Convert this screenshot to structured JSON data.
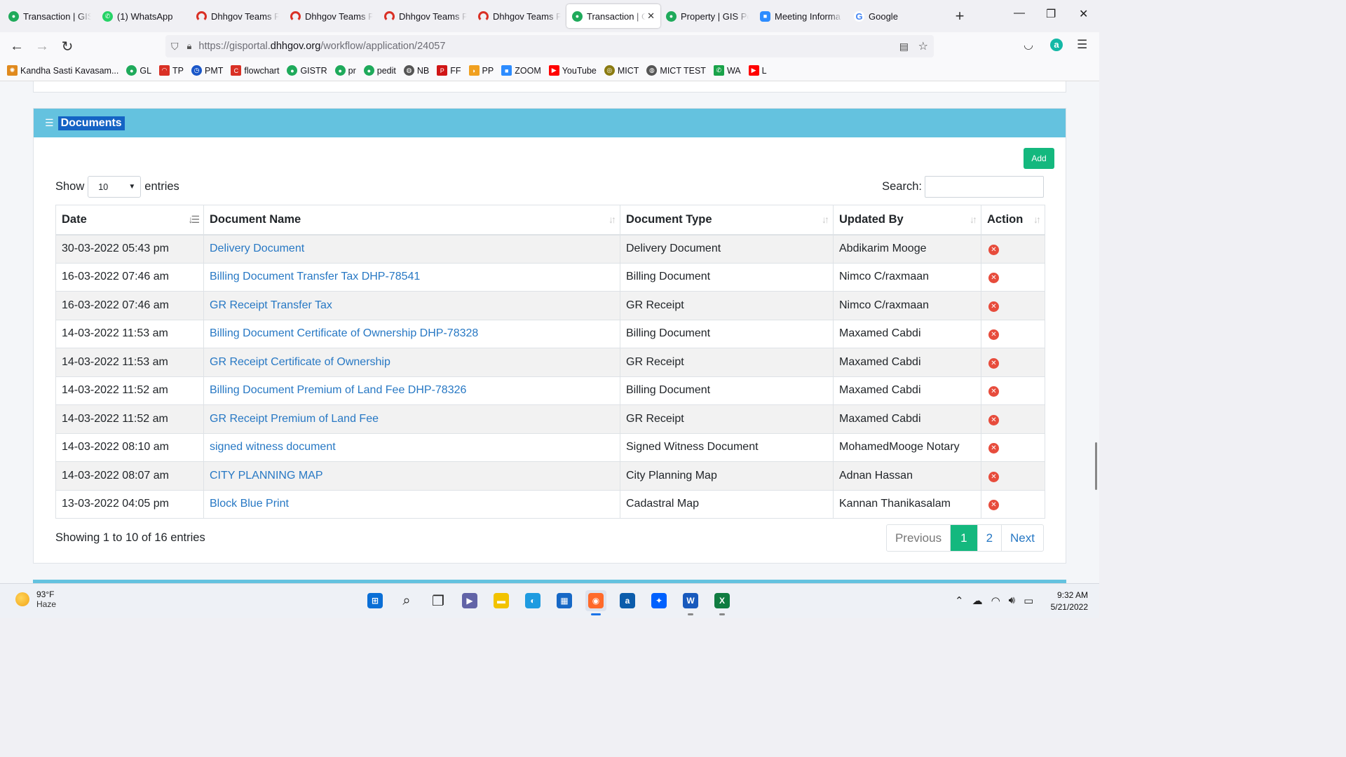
{
  "browser": {
    "tabs": [
      {
        "title": "Transaction | GIS",
        "favicon": "green",
        "icon_name": "gis-favicon-icon"
      },
      {
        "title": "(1) WhatsApp",
        "favicon": "wa",
        "icon_name": "whatsapp-icon"
      },
      {
        "title": "Dhhgov Teams P",
        "favicon": "redarc",
        "icon_name": "teams-portal-icon"
      },
      {
        "title": "Dhhgov Teams P",
        "favicon": "redarc",
        "icon_name": "teams-portal-icon"
      },
      {
        "title": "Dhhgov Teams P",
        "favicon": "redarc",
        "icon_name": "teams-portal-icon"
      },
      {
        "title": "Dhhgov Teams P",
        "favicon": "redarc",
        "icon_name": "teams-portal-icon"
      },
      {
        "title": "Transaction | G",
        "favicon": "green",
        "icon_name": "gis-favicon-icon",
        "active": true
      },
      {
        "title": "Property | GIS Po",
        "favicon": "green",
        "icon_name": "gis-favicon-icon"
      },
      {
        "title": "Meeting Informa",
        "favicon": "zoom",
        "icon_name": "zoom-icon"
      },
      {
        "title": "Google",
        "favicon": "google",
        "icon_name": "google-icon"
      }
    ],
    "url_prefix": "https://gisportal.",
    "url_domain": "dhhgov.org",
    "url_path": "/workflow/application/24057",
    "bookmarks": [
      {
        "label": "Kandha Sasti Kavasam...",
        "icon": "kandha-icon",
        "color": "#e08a1e"
      },
      {
        "label": "GL",
        "icon": "gis-favicon-icon",
        "color": "#1faa5b"
      },
      {
        "label": "TP",
        "icon": "teams-portal-icon",
        "color": "#d93025"
      },
      {
        "label": "PMT",
        "icon": "pmt-icon",
        "color": "#1a57c9"
      },
      {
        "label": "flowchart",
        "icon": "flowchart-icon",
        "color": "#d93025"
      },
      {
        "label": "GISTR",
        "icon": "gis-favicon-icon",
        "color": "#1faa5b"
      },
      {
        "label": "pr",
        "icon": "gis-favicon-icon",
        "color": "#1faa5b"
      },
      {
        "label": "pedit",
        "icon": "gis-favicon-icon",
        "color": "#1faa5b"
      },
      {
        "label": "NB",
        "icon": "globe-icon",
        "color": "#555555"
      },
      {
        "label": "FF",
        "icon": "ff-icon",
        "color": "#d01616"
      },
      {
        "label": "PP",
        "icon": "pp-icon",
        "color": "#f0a020"
      },
      {
        "label": "ZOOM",
        "icon": "zoom-icon",
        "color": "#2d8cff"
      },
      {
        "label": "YouTube",
        "icon": "youtube-icon",
        "color": "#ff0000"
      },
      {
        "label": "MICT",
        "icon": "mict-icon",
        "color": "#8a7a10"
      },
      {
        "label": "MICT TEST",
        "icon": "globe-icon",
        "color": "#555555"
      },
      {
        "label": "WA",
        "icon": "whatsapp-icon",
        "color": "#1aa34a"
      },
      {
        "label": "L",
        "icon": "youtube-icon",
        "color": "#ff0000"
      }
    ]
  },
  "documents": {
    "title": "Documents",
    "add_label": "Add",
    "show_label": "Show",
    "entries_label": "entries",
    "page_length": "10",
    "search_label": "Search:",
    "search_value": "",
    "columns": [
      "Date",
      "Document Name",
      "Document Type",
      "Updated By",
      "Action"
    ],
    "rows": [
      {
        "date": "30-03-2022 05:43 pm",
        "name": "Delivery Document",
        "type": "Delivery Document",
        "updated_by": "Abdikarim Mooge"
      },
      {
        "date": "16-03-2022 07:46 am",
        "name": "Billing Document Transfer Tax DHP-78541",
        "type": "Billing Document",
        "updated_by": "Nimco C/raxmaan"
      },
      {
        "date": "16-03-2022 07:46 am",
        "name": "GR Receipt Transfer Tax",
        "type": "GR Receipt",
        "updated_by": "Nimco C/raxmaan"
      },
      {
        "date": "14-03-2022 11:53 am",
        "name": "Billing Document Certificate of Ownership DHP-78328",
        "type": "Billing Document",
        "updated_by": "Maxamed Cabdi"
      },
      {
        "date": "14-03-2022 11:53 am",
        "name": "GR Receipt Certificate of Ownership",
        "type": "GR Receipt",
        "updated_by": "Maxamed Cabdi"
      },
      {
        "date": "14-03-2022 11:52 am",
        "name": "Billing Document Premium of Land Fee DHP-78326",
        "type": "Billing Document",
        "updated_by": "Maxamed Cabdi"
      },
      {
        "date": "14-03-2022 11:52 am",
        "name": "GR Receipt Premium of Land Fee",
        "type": "GR Receipt",
        "updated_by": "Maxamed Cabdi"
      },
      {
        "date": "14-03-2022 08:10 am",
        "name": "signed witness document",
        "type": "Signed Witness Document",
        "updated_by": "MohamedMooge Notary"
      },
      {
        "date": "14-03-2022 08:07 am",
        "name": "CITY PLANNING MAP",
        "type": "City Planning Map",
        "updated_by": "Adnan Hassan"
      },
      {
        "date": "13-03-2022 04:05 pm",
        "name": "Block Blue Print",
        "type": "Cadastral Map",
        "updated_by": "Kannan Thanikasalam"
      }
    ],
    "info": "Showing 1 to 10 of 16 entries",
    "pagination": {
      "previous": "Previous",
      "pages": [
        "1",
        "2"
      ],
      "current": "1",
      "next": "Next"
    },
    "colors": {
      "header": "#64c2df",
      "title_highlight": "#1463c4",
      "accent": "#14b87e",
      "link": "#2778c4",
      "delete": "#e74c3c"
    }
  },
  "taskbar": {
    "temperature": "93°F",
    "weather": "Haze",
    "time": "9:32 AM",
    "date": "5/21/2022",
    "apps": [
      {
        "name": "windows-start-icon",
        "color": "#0a6fd6",
        "glyph": "⊞"
      },
      {
        "name": "search-icon",
        "color": "#222222",
        "glyph": "⌕"
      },
      {
        "name": "task-view-icon",
        "color": "#222222",
        "glyph": "❐"
      },
      {
        "name": "teams-chat-icon",
        "color": "#6264a7",
        "glyph": "▶"
      },
      {
        "name": "file-explorer-icon",
        "color": "#f2c300",
        "glyph": "▬"
      },
      {
        "name": "edge-icon",
        "color": "#1e9be0",
        "glyph": "◐"
      },
      {
        "name": "store-icon",
        "color": "#1668c6",
        "glyph": "▦"
      },
      {
        "name": "firefox-icon",
        "color": "#ff6a2a",
        "glyph": "◉",
        "active": true
      },
      {
        "name": "amazon-icon",
        "color": "#0b5cab",
        "glyph": "a"
      },
      {
        "name": "dropbox-icon",
        "color": "#0061fe",
        "glyph": "✦"
      },
      {
        "name": "word-icon",
        "color": "#185abd",
        "glyph": "W"
      },
      {
        "name": "excel-icon",
        "color": "#107c41",
        "glyph": "X"
      }
    ]
  }
}
